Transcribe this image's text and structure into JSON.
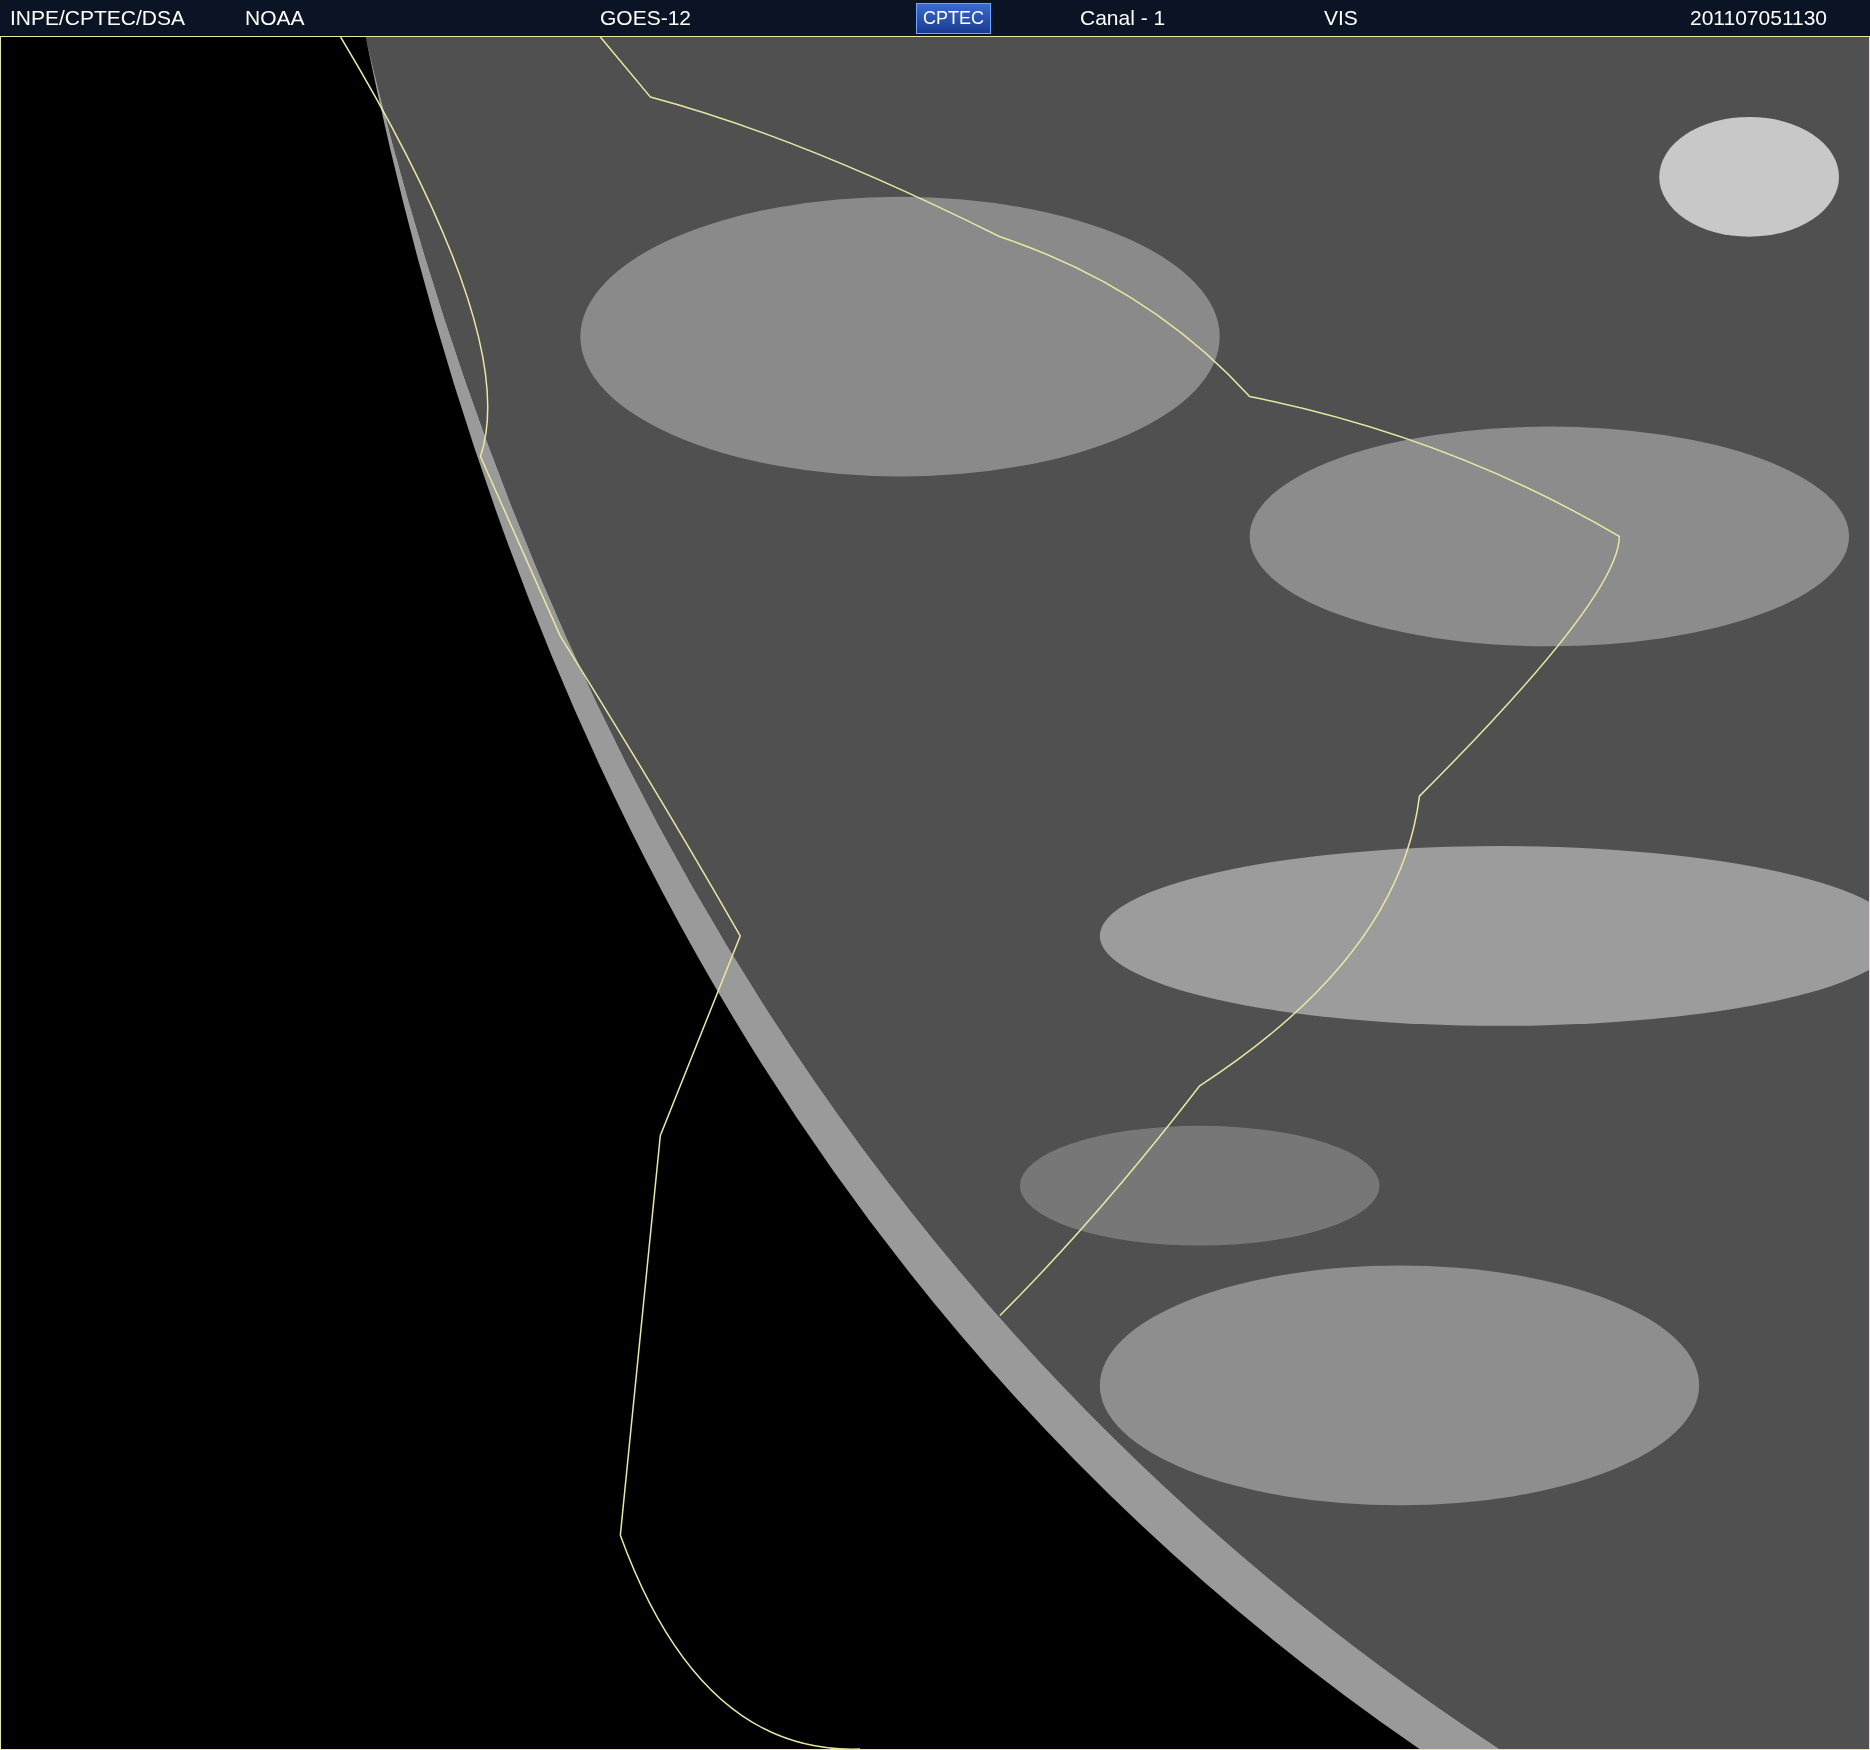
{
  "header": {
    "items": [
      {
        "kind": "text",
        "text": "INPE/CPTEC/DSA"
      },
      {
        "kind": "text",
        "text": "NOAA"
      },
      {
        "kind": "text",
        "text": "GOES-12"
      },
      {
        "kind": "logo",
        "text": "CPTEC"
      },
      {
        "kind": "text",
        "text": "Canal - 1"
      },
      {
        "kind": "text",
        "text": "VIS"
      },
      {
        "kind": "text",
        "text": "201107051130"
      }
    ]
  }
}
